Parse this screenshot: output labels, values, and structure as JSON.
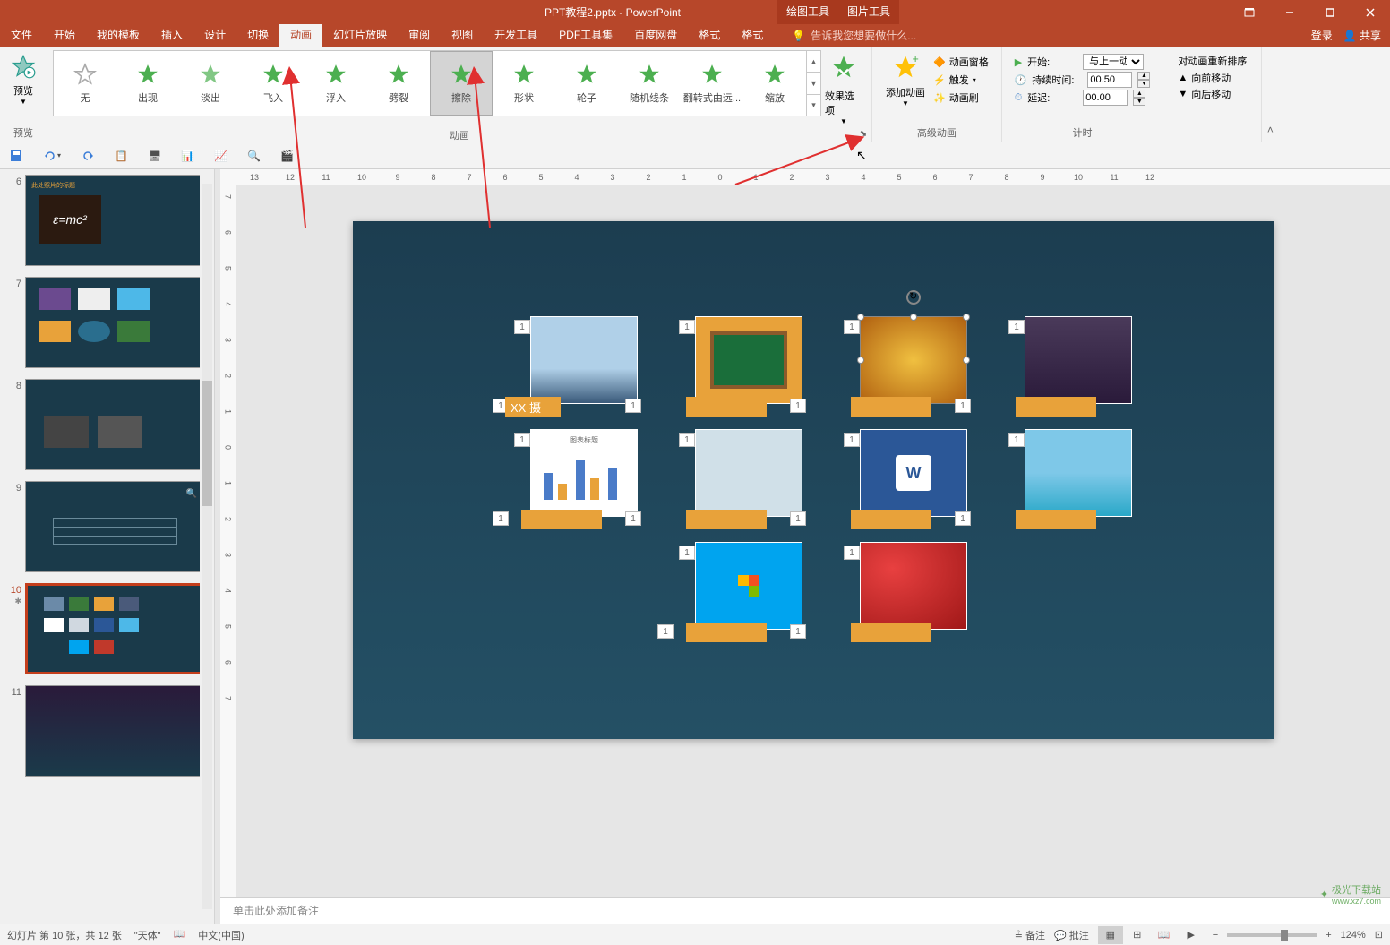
{
  "window": {
    "title": "PPT教程2.pptx - PowerPoint",
    "context_tool1": "绘图工具",
    "context_tool2": "图片工具"
  },
  "tabs": {
    "file": "文件",
    "home": "开始",
    "templates": "我的模板",
    "insert": "插入",
    "design": "设计",
    "transitions": "切换",
    "animations": "动画",
    "slideshow": "幻灯片放映",
    "review": "审阅",
    "view": "视图",
    "developer": "开发工具",
    "pdf": "PDF工具集",
    "baidu": "百度网盘",
    "format1": "格式",
    "format2": "格式",
    "tellme_placeholder": "告诉我您想要做什么...",
    "login": "登录",
    "share": "共享"
  },
  "ribbon": {
    "preview_label": "预览",
    "preview_group": "预览",
    "animations_group": "动画",
    "advanced_group": "高级动画",
    "timing_group": "计时",
    "effects": {
      "none": "无",
      "appear": "出现",
      "fade": "淡出",
      "flyin": "飞入",
      "floatin": "浮入",
      "split": "劈裂",
      "wipe": "擦除",
      "shape": "形状",
      "wheel": "轮子",
      "randombars": "随机线条",
      "growturn": "翻转式由远...",
      "zoom": "缩放"
    },
    "effect_options": "效果选项",
    "add_animation": "添加动画",
    "anim_pane": "动画窗格",
    "trigger": "触发",
    "anim_painter": "动画刷",
    "start_label": "开始:",
    "start_value": "与上一动画...",
    "duration_label": "持续时间:",
    "duration_value": "00.50",
    "delay_label": "延迟:",
    "delay_value": "00.00",
    "reorder_title": "对动画重新排序",
    "move_earlier": "向前移动",
    "move_later": "向后移动"
  },
  "slides": {
    "s6": "6",
    "s7": "7",
    "s8": "8",
    "s9": "9",
    "s10": "10",
    "s11": "11",
    "s6_title": "此处照片的标题"
  },
  "canvas": {
    "anim_number": "1",
    "caption_text": "XX 摄"
  },
  "ruler_h": [
    "13",
    "12",
    "11",
    "10",
    "9",
    "8",
    "7",
    "6",
    "5",
    "4",
    "3",
    "2",
    "1",
    "0",
    "1",
    "2",
    "3",
    "4",
    "5",
    "6",
    "7",
    "8",
    "9",
    "10",
    "11",
    "12"
  ],
  "ruler_v": [
    "7",
    "6",
    "5",
    "4",
    "3",
    "2",
    "1",
    "0",
    "1",
    "2",
    "3",
    "4",
    "5",
    "6",
    "7"
  ],
  "notes": {
    "placeholder": "单击此处添加备注"
  },
  "status": {
    "slide_info": "幻灯片 第 10 张，共 12 张",
    "theme": "\"天体\"",
    "language": "中文(中国)",
    "notes_btn": "备注",
    "comments_btn": "批注",
    "zoom_value": "124%"
  },
  "watermark": "极光下载站",
  "watermark_url": "www.xz7.com"
}
